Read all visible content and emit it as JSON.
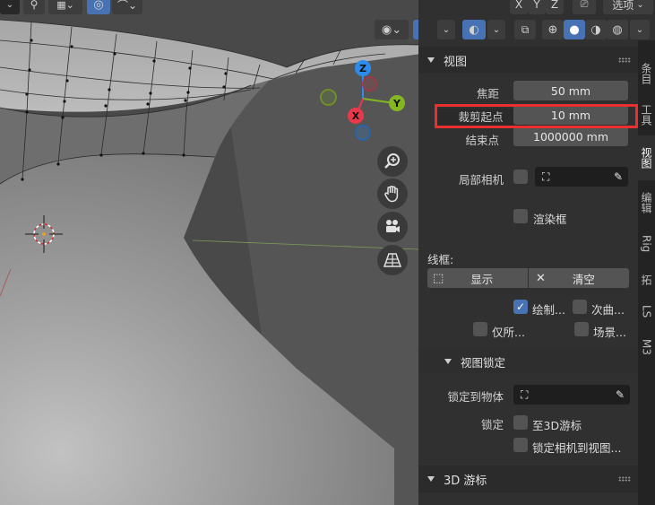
{
  "viewport": {
    "header": {
      "right_dropdown": "选项",
      "axis_x": "X",
      "axis_y": "Y",
      "axis_z": "Z"
    },
    "gizmo": {
      "x": "X",
      "y": "Y",
      "z": "Z"
    }
  },
  "panel": {
    "view_section": {
      "title": "视图",
      "focal_length_label": "焦距",
      "focal_length_value": "50 mm",
      "clip_start_label": "裁剪起点",
      "clip_start_value": "10 mm",
      "clip_end_label": "结束点",
      "clip_end_value": "1000000 mm",
      "local_camera_label": "局部相机",
      "render_region_label": "渲染框",
      "wireframe_label": "线框:",
      "show_label": "显示",
      "clear_label": "清空",
      "draw_label": "绘制...",
      "sub_label": "次曲...",
      "only_label": "仅所...",
      "scene_label": "场景..."
    },
    "view_lock": {
      "title": "视图锁定",
      "lock_to_object_label": "锁定到物体",
      "lock_label": "锁定",
      "to_3d_cursor": "至3D游标",
      "lock_camera_to_view": "锁定相机到视图..."
    },
    "cursor_section": {
      "title": "3D 游标"
    }
  },
  "tabs": [
    "条目",
    "工具",
    "视图",
    "编辑",
    "Rig",
    "拓",
    "LS",
    "M3"
  ],
  "colors": {
    "accent": "#4772b3",
    "highlight_box": "#e8302f",
    "axis_x": "#e8394a",
    "axis_y": "#84b622",
    "axis_z": "#2d8ceb"
  }
}
